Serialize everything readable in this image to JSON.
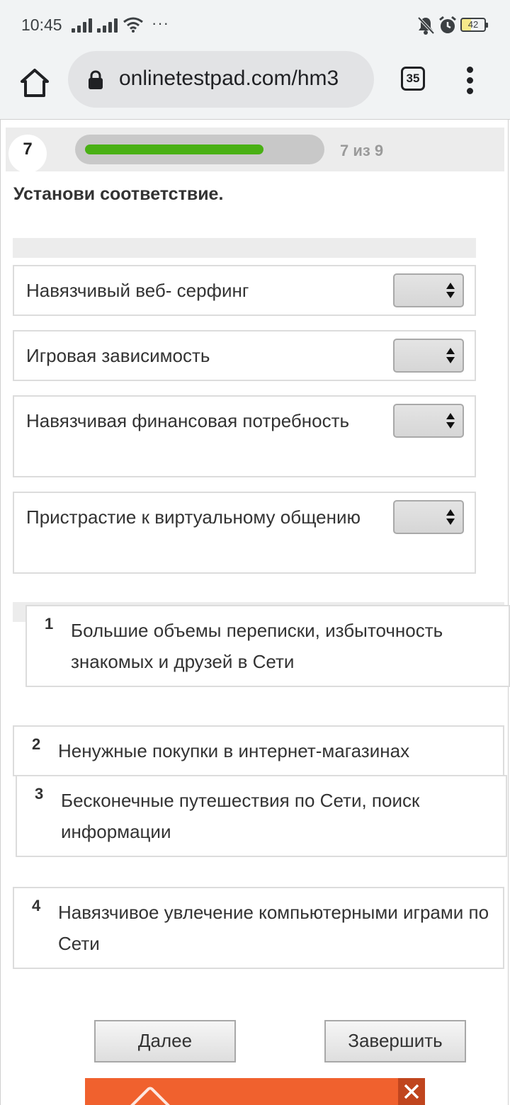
{
  "status_bar": {
    "time": "10:45",
    "more_indicator": "···",
    "battery_level": "42",
    "icons": [
      "signal-icon",
      "signal-icon",
      "wifi-icon",
      "mute-icon",
      "alarm-icon",
      "battery-icon"
    ]
  },
  "browser": {
    "url": "onlinetestpad.com/hm3",
    "tab_count": "35",
    "icons": [
      "home-icon",
      "lock-icon",
      "tabs-icon",
      "menu-icon"
    ]
  },
  "question": {
    "number": "7",
    "progress_label": "7 из 9",
    "progress_current": 7,
    "progress_total": 9,
    "title": "Установи соответствие."
  },
  "match_rows": [
    {
      "label": "Навязчивый веб- серфинг",
      "selected": ""
    },
    {
      "label": "Игровая зависимость",
      "selected": ""
    },
    {
      "label": "Навязчивая финансовая потребность",
      "selected": ""
    },
    {
      "label": "Пристрастие к виртуальному общению",
      "selected": ""
    }
  ],
  "answers": [
    {
      "num": "1",
      "text": "Большие объемы переписки, избыточность знакомых и друзей в Сети"
    },
    {
      "num": "2",
      "text": "Ненужные покупки в интернет-магазинах"
    },
    {
      "num": "3",
      "text": "Бесконечные путешествия по Сети, поиск информации"
    },
    {
      "num": "4",
      "text": "Навязчивое увлечение компьютерными играми по Сети"
    }
  ],
  "buttons": {
    "next": "Далее",
    "finish": "Завершить"
  },
  "colors": {
    "progress_fill": "#49b014",
    "progress_track": "#c8c8c8",
    "ad_background": "#f0612e",
    "ad_close_background": "#c0451e"
  }
}
